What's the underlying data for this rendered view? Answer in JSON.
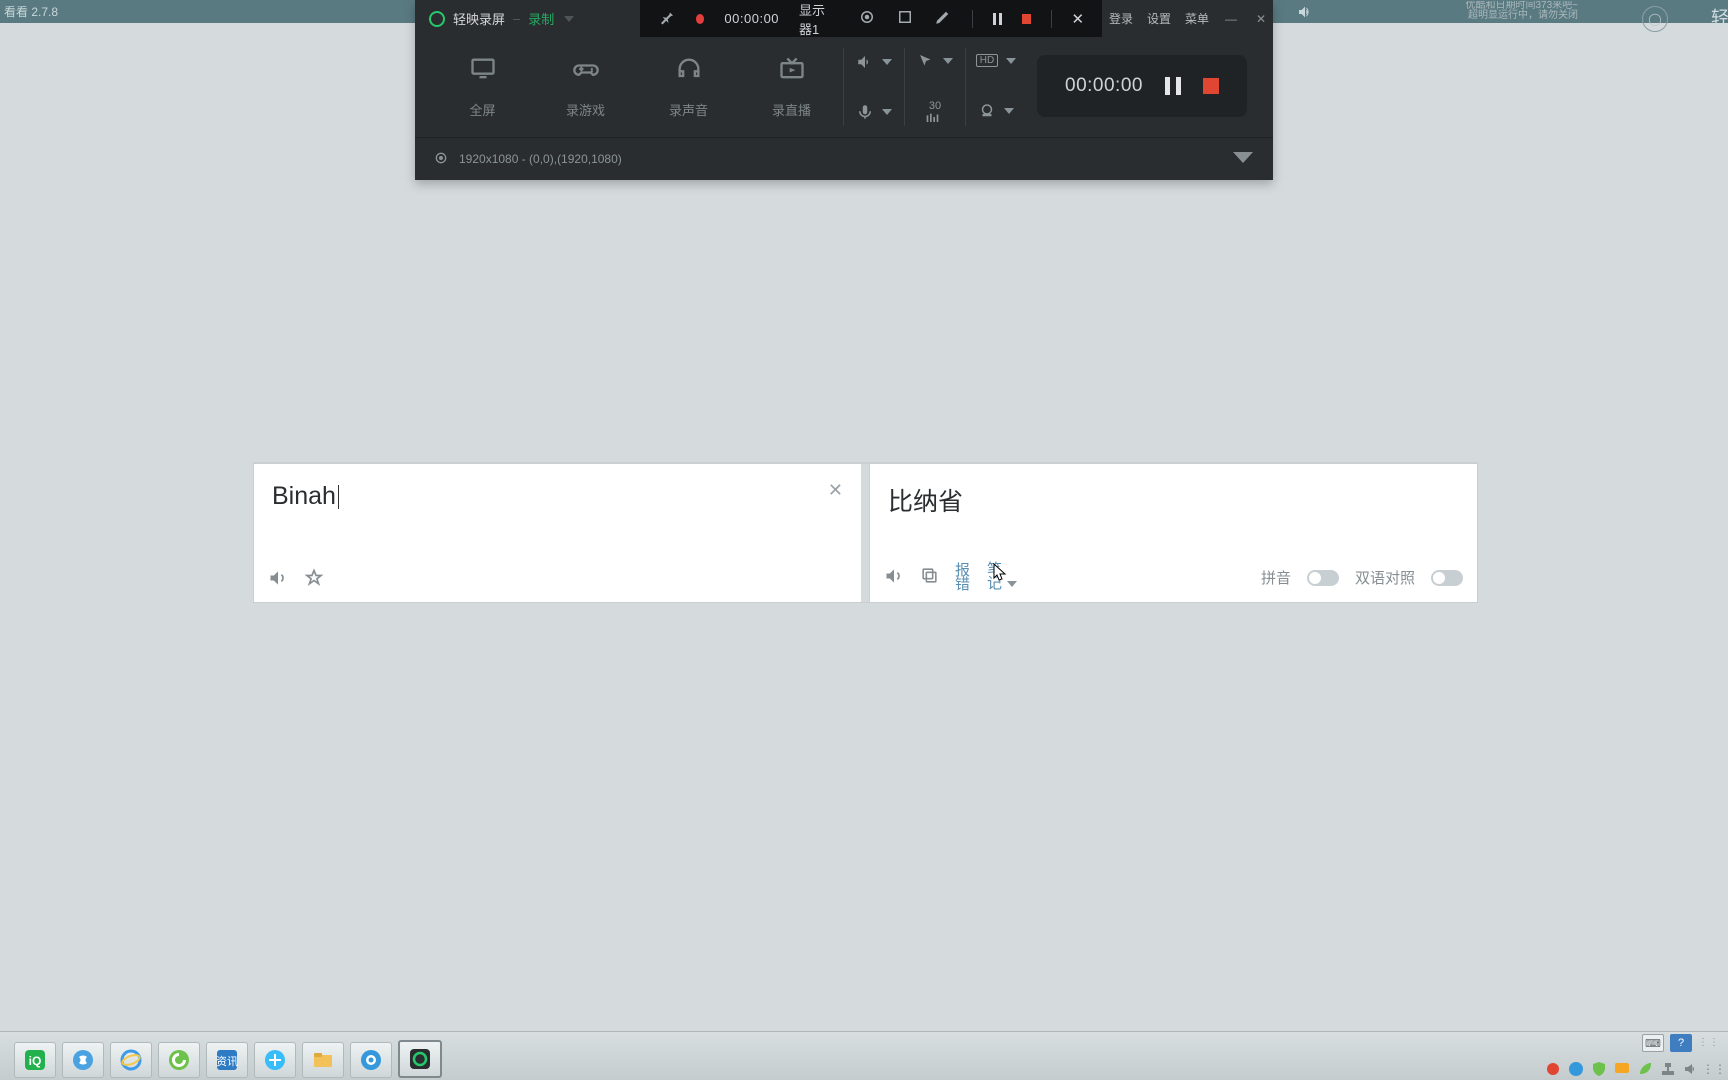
{
  "background_app": {
    "title_fragment": "看看 2.7.8"
  },
  "system_flyout": {
    "line1": "优酷和日期时间373来吧~",
    "line2": "超明显运行中，请勿关闭"
  },
  "watermark_partial": "轻",
  "recorder": {
    "brand": "轻映录屏",
    "mode_current": "录制",
    "top_time": "00:00:00",
    "monitor_label": "显示器1",
    "link_login": "登录",
    "link_settings": "设置",
    "link_menu": "菜单",
    "modes": {
      "fullscreen": "全屏",
      "game": "录游戏",
      "audio": "录声音",
      "live": "录直播"
    },
    "frame_rate": "30",
    "panel_time": "00:00:00",
    "status_line": "1920x1080 - (0,0),(1920,1080)"
  },
  "translate": {
    "source_text": "Binah",
    "target_text": "比纳省",
    "left_actions": {
      "sound": "朗读",
      "star": "收藏"
    },
    "right_actions": {
      "report": "报错",
      "notes": "笔记",
      "pinyin_label": "拼音",
      "bilingual_label": "双语对照"
    }
  },
  "taskbar": {
    "icons": [
      "iqiyi",
      "sogou",
      "ie",
      "360se",
      "news",
      "app-blue",
      "files",
      "browser",
      "recorder"
    ]
  },
  "tray": {
    "items": [
      "record",
      "globe",
      "shield",
      "chat",
      "leaf",
      "net",
      "sound",
      "menu"
    ]
  }
}
